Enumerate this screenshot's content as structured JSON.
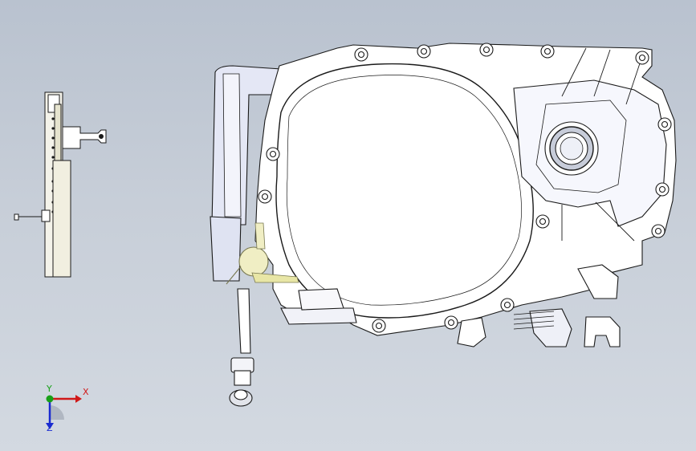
{
  "viewport": {
    "background_top": "#b9c2cf",
    "background_bottom": "#d3d9e1",
    "part_fill": "#ffffff",
    "part_shade": "#dfe4f3",
    "edge_color": "#1a1a1a",
    "highlight_color": "#e8e6a6"
  },
  "triad": {
    "x_label": "X",
    "y_label": "Y",
    "z_label": "Z",
    "x_color": "#d01818",
    "y_color": "#18a018",
    "z_color": "#1a2bd0"
  }
}
